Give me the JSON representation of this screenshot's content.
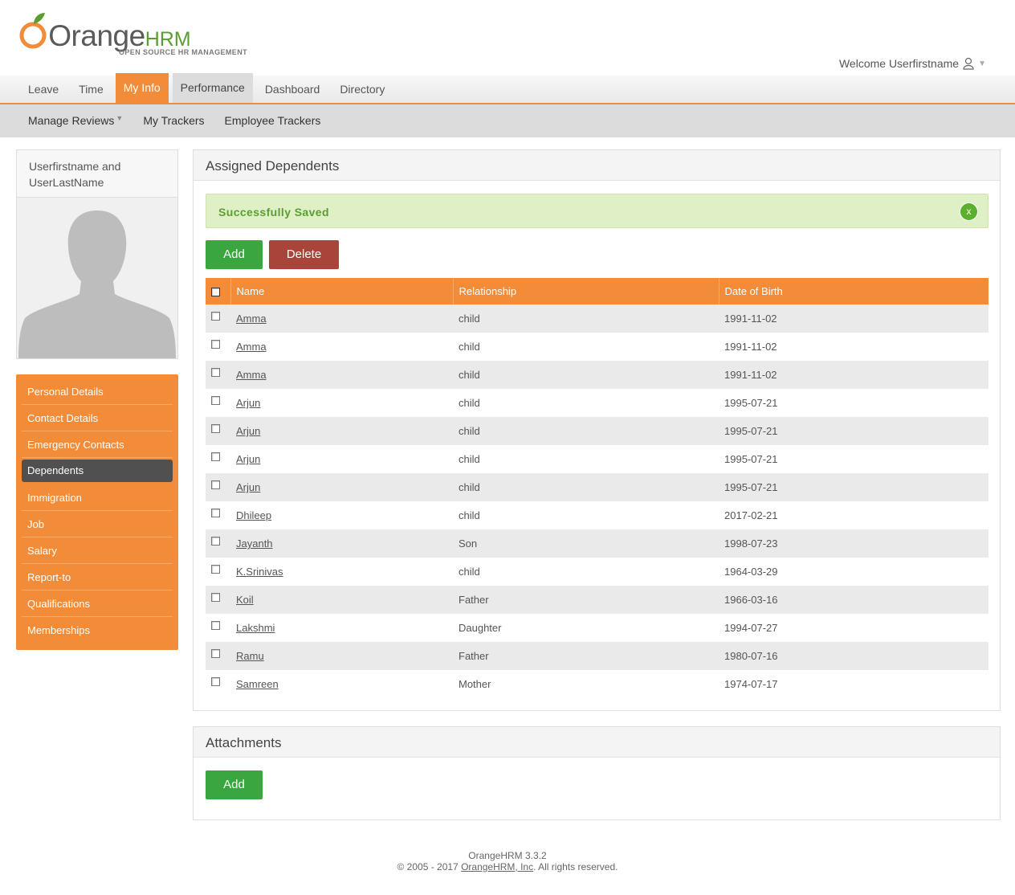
{
  "header": {
    "brand_main": "Orange",
    "brand_hrm": "HRM",
    "tagline": "OPEN SOURCE HR MANAGEMENT",
    "welcome": "Welcome Userfirstname"
  },
  "topnav": {
    "items": [
      {
        "label": "Leave"
      },
      {
        "label": "Time"
      },
      {
        "label": "My Info"
      },
      {
        "label": "Performance"
      },
      {
        "label": "Dashboard"
      },
      {
        "label": "Directory"
      }
    ]
  },
  "subnav": {
    "items": [
      {
        "label": "Manage Reviews"
      },
      {
        "label": "My Trackers"
      },
      {
        "label": "Employee Trackers"
      }
    ]
  },
  "profile": {
    "name": "Userfirstname and UserLastName"
  },
  "sidebar": {
    "items": [
      {
        "label": "Personal Details"
      },
      {
        "label": "Contact Details"
      },
      {
        "label": "Emergency Contacts"
      },
      {
        "label": "Dependents"
      },
      {
        "label": "Immigration"
      },
      {
        "label": "Job"
      },
      {
        "label": "Salary"
      },
      {
        "label": "Report-to"
      },
      {
        "label": "Qualifications"
      },
      {
        "label": "Memberships"
      }
    ]
  },
  "dependents": {
    "title": "Assigned Dependents",
    "message": "Successfully Saved",
    "close_label": "x",
    "add_label": "Add",
    "delete_label": "Delete",
    "columns": [
      "Name",
      "Relationship",
      "Date of Birth"
    ],
    "rows": [
      {
        "name": "Amma",
        "relationship": "child",
        "dob": "1991-11-02"
      },
      {
        "name": "Amma",
        "relationship": "child",
        "dob": "1991-11-02"
      },
      {
        "name": "Amma",
        "relationship": "child",
        "dob": "1991-11-02"
      },
      {
        "name": "Arjun",
        "relationship": "child",
        "dob": "1995-07-21"
      },
      {
        "name": "Arjun",
        "relationship": "child",
        "dob": "1995-07-21"
      },
      {
        "name": "Arjun",
        "relationship": "child",
        "dob": "1995-07-21"
      },
      {
        "name": "Arjun",
        "relationship": "child",
        "dob": "1995-07-21"
      },
      {
        "name": "Dhileep",
        "relationship": "child",
        "dob": "2017-02-21"
      },
      {
        "name": "Jayanth",
        "relationship": "Son",
        "dob": "1998-07-23"
      },
      {
        "name": "K.Srinivas",
        "relationship": "child",
        "dob": "1964-03-29"
      },
      {
        "name": "Koil",
        "relationship": "Father",
        "dob": "1966-03-16"
      },
      {
        "name": "Lakshmi",
        "relationship": "Daughter",
        "dob": "1994-07-27"
      },
      {
        "name": "Ramu",
        "relationship": "Father",
        "dob": "1980-07-16"
      },
      {
        "name": "Samreen",
        "relationship": "Mother",
        "dob": "1974-07-17"
      }
    ]
  },
  "attachments": {
    "title": "Attachments",
    "add_label": "Add"
  },
  "footer": {
    "version": "OrangeHRM 3.3.2",
    "copyright_prefix": "© 2005 - 2017",
    "company_link": "OrangeHRM, Inc",
    "copyright_suffix": ". All rights reserved."
  },
  "colors": {
    "accent": "#f28c38",
    "success_bg": "#dff0c6",
    "add_button": "#3aa63f",
    "delete_button": "#a8443a"
  }
}
